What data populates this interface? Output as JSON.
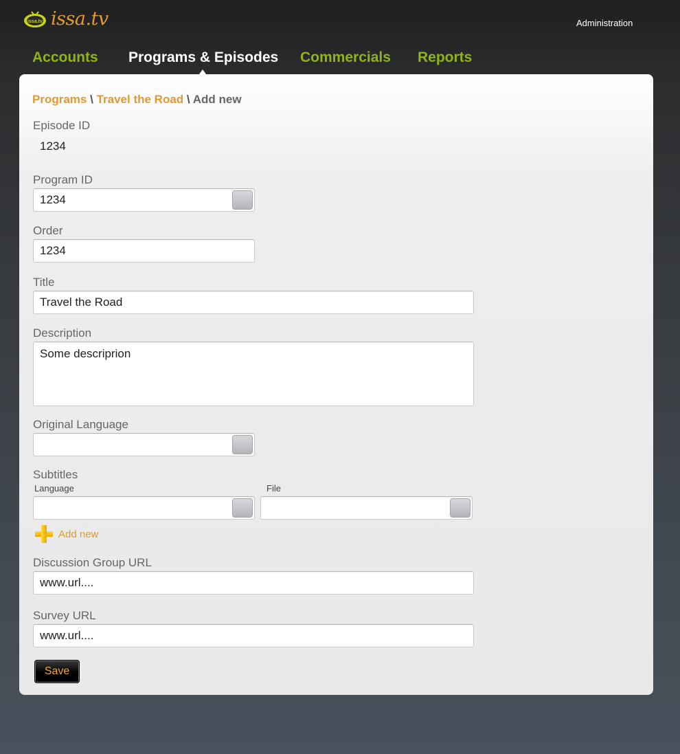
{
  "brand": {
    "logo_badge_text": "issa.tv",
    "logo_text": "issa.tv"
  },
  "header": {
    "admin_link": "Administration"
  },
  "nav": {
    "items": [
      {
        "label": "Accounts",
        "active": false
      },
      {
        "label": "Programs & Episodes",
        "active": true
      },
      {
        "label": "Commercials",
        "active": false
      },
      {
        "label": "Reports",
        "active": false
      }
    ]
  },
  "breadcrumb": {
    "items": [
      "Programs",
      "Travel the Road",
      "Add new"
    ],
    "separator": "\\"
  },
  "form": {
    "episode_id": {
      "label": "Episode ID",
      "value": "1234"
    },
    "program_id": {
      "label": "Program ID",
      "value": "1234"
    },
    "order": {
      "label": "Order",
      "value": "1234"
    },
    "title": {
      "label": "Title",
      "value": "Travel the Road"
    },
    "description": {
      "label": "Description",
      "value": "Some descriprion"
    },
    "original_language": {
      "label": "Original Language",
      "value": ""
    },
    "subtitles": {
      "label": "Subtitles",
      "language_label": "Language",
      "language_value": "",
      "file_label": "File",
      "file_value": "",
      "add_new_label": "Add new"
    },
    "discussion_group_url": {
      "label": "Discussion Group URL",
      "value": "www.url...."
    },
    "survey_url": {
      "label": "Survey URL",
      "value": "www.url...."
    },
    "save_label": "Save"
  },
  "colors": {
    "accent_orange": "#e09a30",
    "nav_green": "#8fb31a",
    "header_dark": "#1f1f1f",
    "panel_bg": "#e9e9eb"
  },
  "icons": {
    "logo": "tv-icon",
    "add": "plus-icon",
    "select": "dropdown-button"
  }
}
